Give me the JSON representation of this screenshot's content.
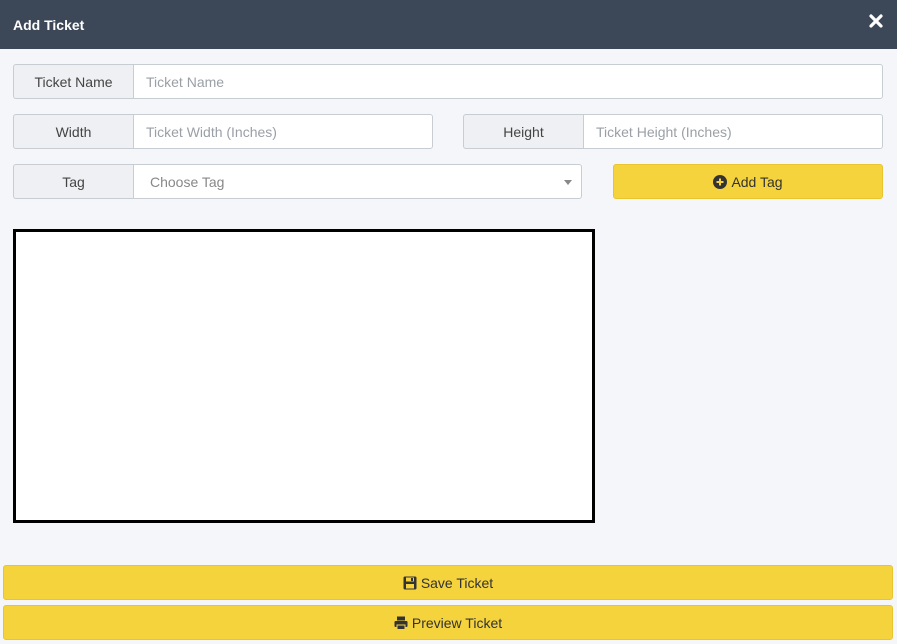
{
  "header": {
    "title": "Add Ticket"
  },
  "form": {
    "ticket_name": {
      "label": "Ticket Name",
      "placeholder": "Ticket Name",
      "value": ""
    },
    "width": {
      "label": "Width",
      "placeholder": "Ticket Width (Inches)",
      "value": ""
    },
    "height": {
      "label": "Height",
      "placeholder": "Ticket Height (Inches)",
      "value": ""
    },
    "tag": {
      "label": "Tag",
      "selected": "Choose Tag"
    },
    "add_tag_label": "Add Tag"
  },
  "footer": {
    "save_label": "Save Ticket",
    "preview_label": "Preview Ticket"
  },
  "colors": {
    "header_bg": "#3c4858",
    "accent_yellow": "#f5d33d",
    "page_bg": "#f4f6f9"
  },
  "icons": {
    "close": "close-icon",
    "add_tag": "plus-circle-icon",
    "save": "save-icon",
    "preview": "print-icon"
  }
}
